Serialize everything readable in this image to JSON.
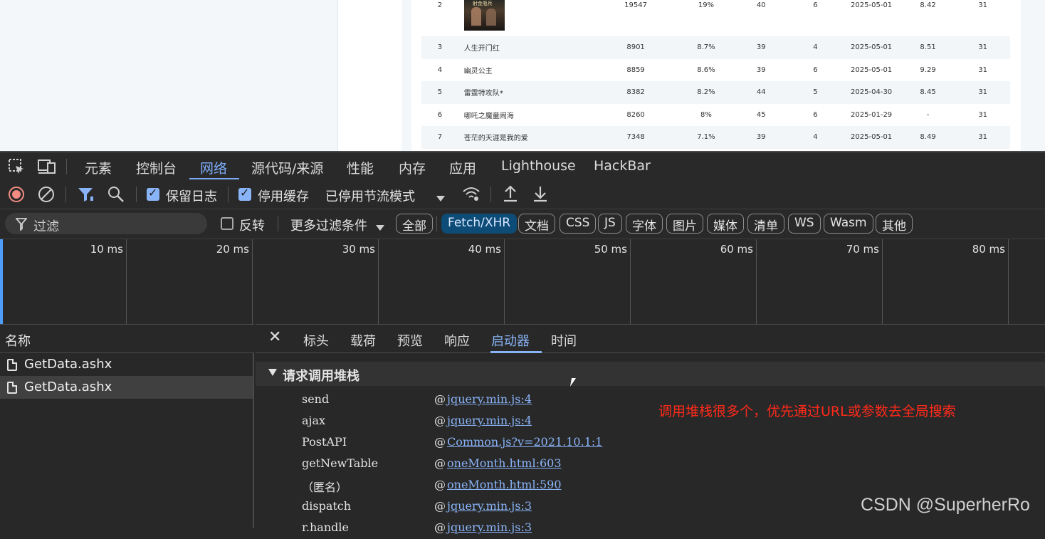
{
  "webpage": {
    "rows": [
      {
        "rank": "2",
        "name": "",
        "poster_title": "射金瓶兵",
        "value": "19547",
        "share": "19%",
        "c3": "40",
        "c4": "6",
        "date": "2025-05-01",
        "score": "8.42",
        "days": "31"
      },
      {
        "rank": "3",
        "name": "人生开门红",
        "value": "8901",
        "share": "8.7%",
        "c3": "39",
        "c4": "4",
        "date": "2025-05-01",
        "score": "8.51",
        "days": "31"
      },
      {
        "rank": "4",
        "name": "幽灵公主",
        "value": "8859",
        "share": "8.6%",
        "c3": "39",
        "c4": "6",
        "date": "2025-05-01",
        "score": "9.29",
        "days": "31"
      },
      {
        "rank": "5",
        "name": "雷霆特攻队*",
        "value": "8382",
        "share": "8.2%",
        "c3": "44",
        "c4": "5",
        "date": "2025-04-30",
        "score": "8.45",
        "days": "31"
      },
      {
        "rank": "6",
        "name": "哪吒之魔童闹海",
        "value": "8260",
        "share": "8%",
        "c3": "45",
        "c4": "6",
        "date": "2025-01-29",
        "score": "-",
        "days": "31"
      },
      {
        "rank": "7",
        "name": "苍茫的天涯是我的爱",
        "value": "7348",
        "share": "7.1%",
        "c3": "39",
        "c4": "4",
        "date": "2025-05-01",
        "score": "8.49",
        "days": "31"
      }
    ]
  },
  "devtools": {
    "main_tabs": [
      "元素",
      "控制台",
      "网络",
      "源代码/来源",
      "性能",
      "内存",
      "应用",
      "Lighthouse",
      "HackBar"
    ],
    "active_main_tab": "网络",
    "toolbar": {
      "preserve_log_label": "保留日志",
      "preserve_log_checked": true,
      "disable_cache_label": "停用缓存",
      "disable_cache_checked": true,
      "throttle_value": "已停用节流模式"
    },
    "filter": {
      "placeholder": "过滤",
      "invert_label": "反转",
      "invert_checked": false,
      "more_filters_label": "更多过滤条件",
      "chips": [
        "全部",
        "Fetch/XHR",
        "文档",
        "CSS",
        "JS",
        "字体",
        "图片",
        "媒体",
        "清单",
        "WS",
        "Wasm",
        "其他"
      ],
      "active_chip": "Fetch/XHR"
    },
    "timeline_ticks": [
      "10 ms",
      "20 ms",
      "30 ms",
      "40 ms",
      "50 ms",
      "60 ms",
      "70 ms",
      "80 ms"
    ],
    "name_header": "名称",
    "requests": [
      "GetData.ashx",
      "GetData.ashx"
    ],
    "selected_request_index": 1,
    "detail_tabs": [
      "标头",
      "载荷",
      "预览",
      "响应",
      "启动器",
      "时间"
    ],
    "active_detail_tab": "启动器",
    "stack_title": "请求调用堆栈",
    "stack_frames": [
      {
        "fn": "send",
        "loc": "jquery.min.js:4"
      },
      {
        "fn": "ajax",
        "loc": "jquery.min.js:4"
      },
      {
        "fn": "PostAPI",
        "loc": "Common.js?v=2021.10.1:1"
      },
      {
        "fn": "getNewTable",
        "loc": "oneMonth.html:603"
      },
      {
        "fn": "（匿名）",
        "loc": "oneMonth.html:590"
      },
      {
        "fn": "dispatch",
        "loc": "jquery.min.js:3"
      },
      {
        "fn": "r.handle",
        "loc": "jquery.min.js:3"
      }
    ],
    "annotation": "调用堆栈很多个，优先通过URL或参数去全局搜索",
    "watermark": "CSDN @SuperherRo"
  },
  "colors": {
    "accent": "#8ab4f8",
    "active_chip_bg": "#0e4c78",
    "annotation": "#ff2a1a",
    "record_red": "#f28b82"
  }
}
